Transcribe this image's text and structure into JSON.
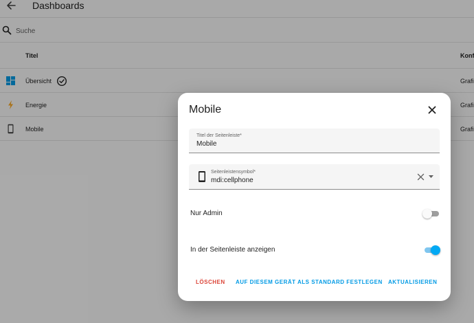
{
  "header": {
    "title": "Dashboards"
  },
  "search": {
    "placeholder": "Suche"
  },
  "table": {
    "columns": {
      "title": "Titel",
      "config": "Konfi"
    },
    "rows": [
      {
        "icon": "view-dashboard-icon",
        "label": "Übersicht",
        "config": "Grafi",
        "default_marker": "check-circle-icon"
      },
      {
        "icon": "lightning-bolt-icon",
        "label": "Energie",
        "config": "Grafi"
      },
      {
        "icon": "cellphone-icon",
        "label": "Mobile",
        "config": "Grafi"
      }
    ]
  },
  "dialog": {
    "title": "Mobile",
    "sidebar_title_field": {
      "label": "Titel der Seitenleiste*",
      "value": "Mobile"
    },
    "sidebar_icon_field": {
      "label": "Seitenleistensymbol*",
      "value": "mdi:cellphone",
      "icon": "cellphone-icon"
    },
    "admin_only": {
      "label": "Nur Admin",
      "on": false
    },
    "show_in_sidebar": {
      "label": "In der Seitenleiste anzeigen",
      "on": true
    },
    "actions": {
      "delete": "LÖSCHEN",
      "set_default": "AUF DIESEM GERÄT ALS STANDARD FESTLEGEN",
      "update": "AKTUALISIEREN"
    }
  },
  "colors": {
    "accent": "#03a9f4",
    "danger": "#db4437",
    "energy_icon": "#f9a825",
    "dashboard_icon": "#039be5"
  }
}
